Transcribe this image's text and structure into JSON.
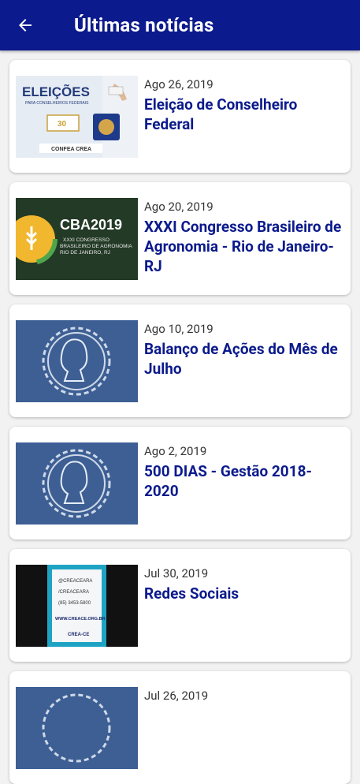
{
  "appbar": {
    "title": "Últimas notícias",
    "back_icon": "arrow-left-icon"
  },
  "colors": {
    "primary": "#0b1a8c",
    "logo_blue": "#3d5f94",
    "cba_green": "#233a26"
  },
  "news": [
    {
      "date": "Ago 26, 2019",
      "title": "Eleição de Conselheiro Federal",
      "thumb": "eleicoes-banner",
      "thumb_text": {
        "heading": "ELEIÇÕES",
        "sub": "PARA CONSELHEIROS FEDERAIS",
        "date_label": "30",
        "footer": "CONFEA CREA"
      }
    },
    {
      "date": "Ago 20, 2019",
      "title": "XXXI Congresso Brasileiro de Agronomia - Rio de Janeiro-RJ",
      "thumb": "cba-banner",
      "thumb_text": {
        "heading": "CBA2019",
        "line1": "XXXI CONGRESSO",
        "line2": "BRASILEIRO DE AGRONOMIA",
        "line3": "RIO DE JANEIRO, RJ"
      }
    },
    {
      "date": "Ago 10, 2019",
      "title": "Balanço de Ações do Mês de Julho",
      "thumb": "crea-seal"
    },
    {
      "date": "Ago 2, 2019",
      "title": "500 DIAS - Gestão 2018-2020",
      "thumb": "crea-seal"
    },
    {
      "date": "Jul 30, 2019",
      "title": "Redes Sociais",
      "thumb": "redes-sociais-banner",
      "thumb_text": {
        "l1": "@CREACEARA",
        "l2": "/CREACEARA",
        "l3": "(85) 3453-5800",
        "l4": "WWW.CREACE.ORG.BR",
        "footer": "CREA-CE"
      }
    },
    {
      "date": "Jul 26, 2019",
      "title": "",
      "thumb": "crea-seal"
    }
  ]
}
